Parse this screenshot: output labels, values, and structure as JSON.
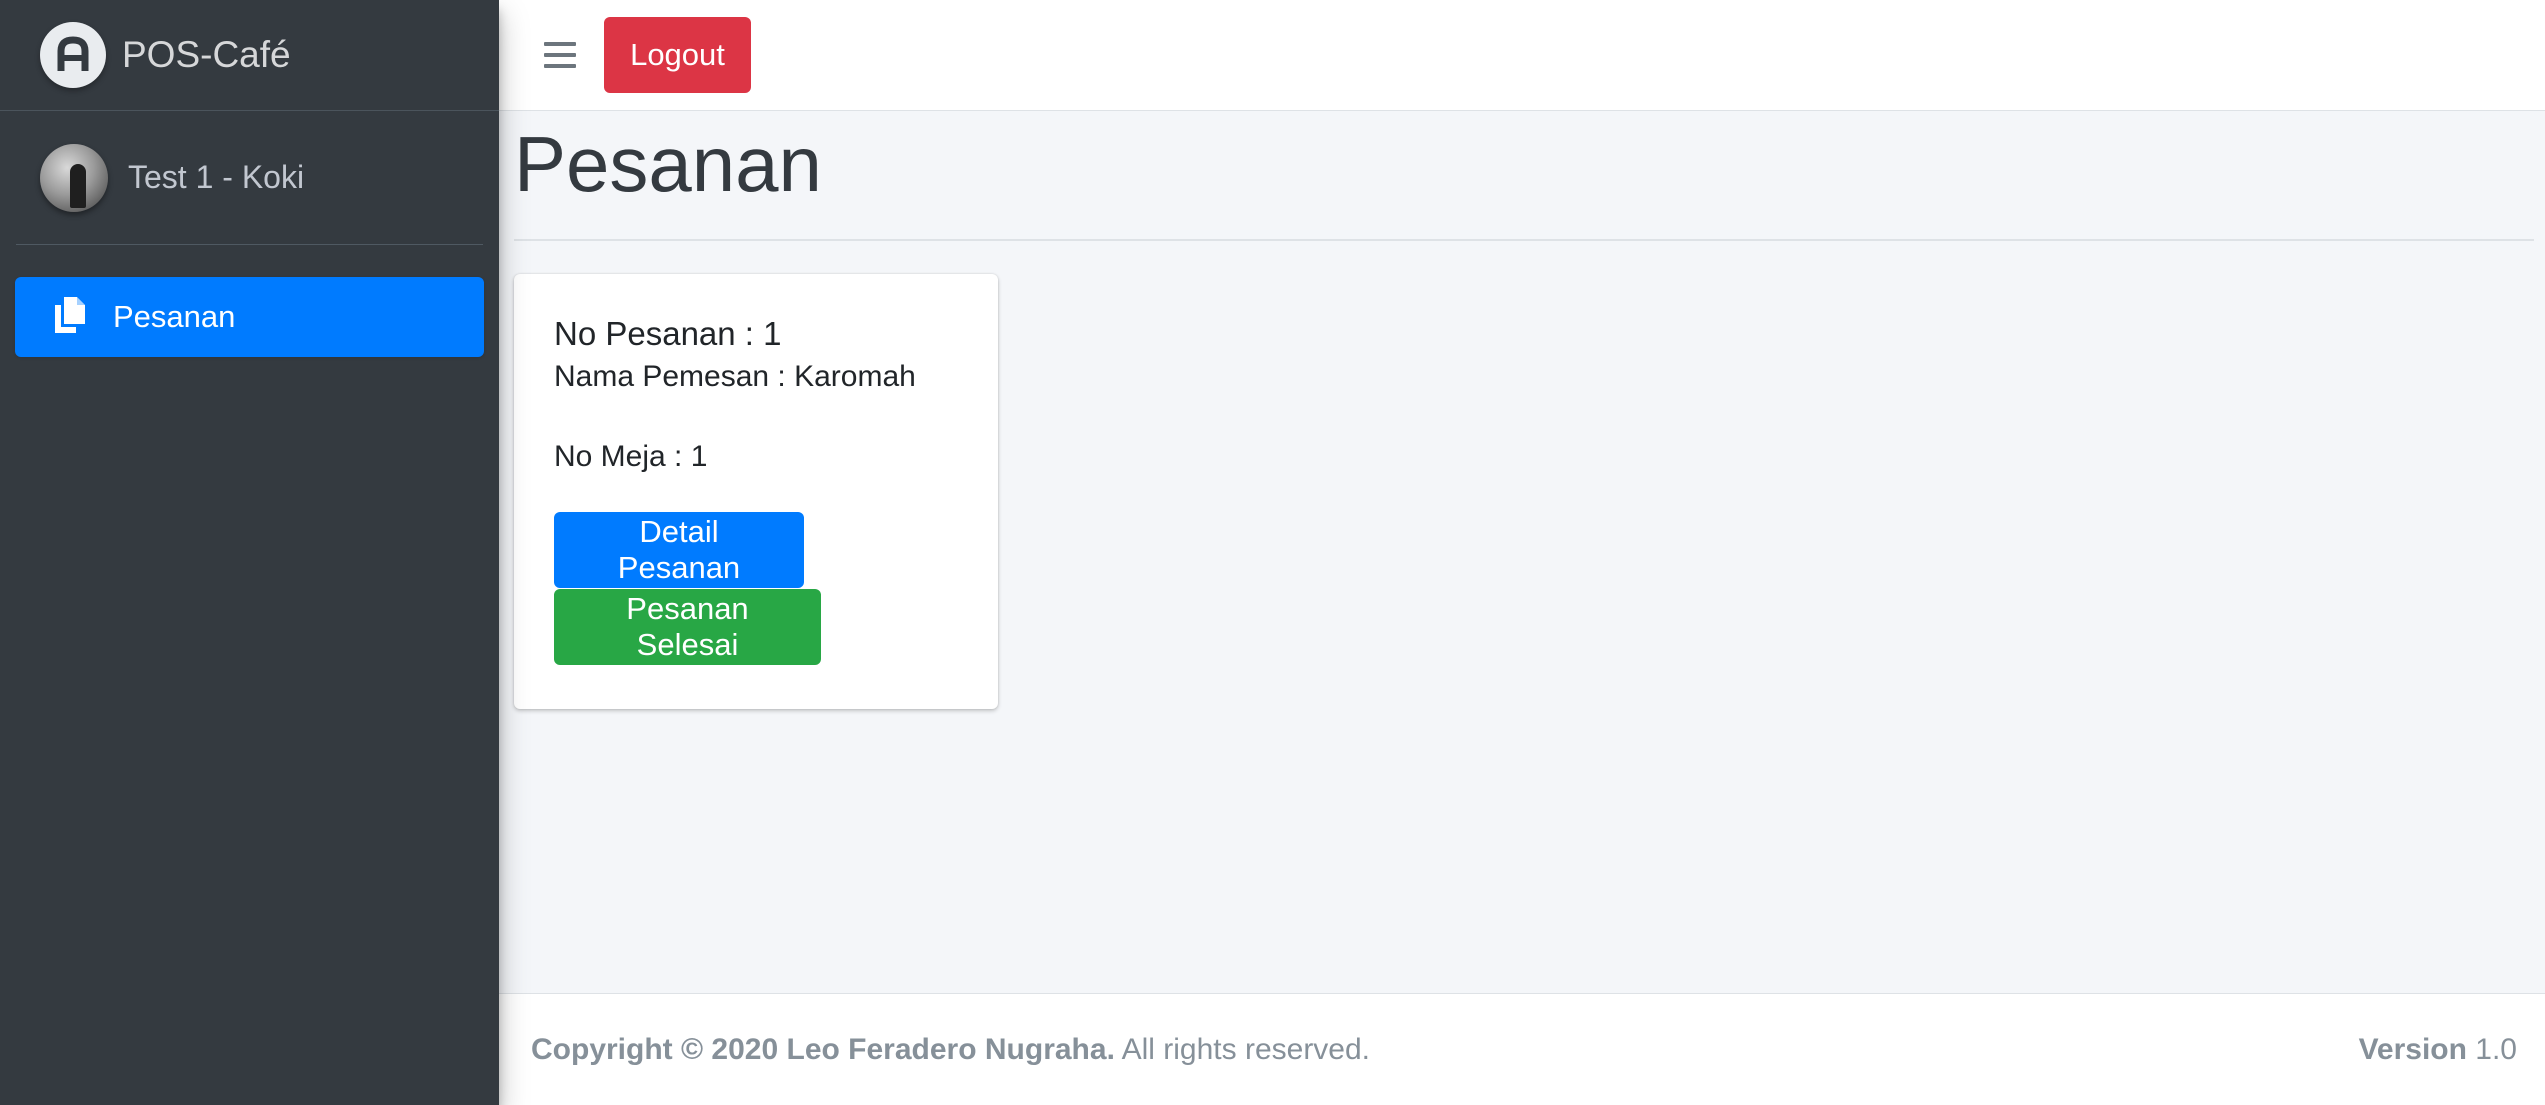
{
  "brand": {
    "name": "POS-Café",
    "logo_icon": "letter-a-logo-icon"
  },
  "user": {
    "name": "Test 1 - Koki"
  },
  "sidebar": {
    "items": [
      {
        "label": "Pesanan",
        "icon": "copy-files-icon",
        "active": true
      }
    ]
  },
  "navbar": {
    "menu_icon": "hamburger-menu-icon",
    "logout_label": "Logout"
  },
  "page": {
    "title": "Pesanan"
  },
  "orders": [
    {
      "order_no": "No Pesanan : 1",
      "customer": "Nama Pemesan : Karomah",
      "table": "No Meja : 1",
      "detail_label": "Detail Pesanan",
      "done_label": "Pesanan Selesai"
    }
  ],
  "footer": {
    "copyright": "Copyright © 2020 Leo Feradero Nugraha.",
    "rights": " All rights reserved.",
    "version_label": "Version",
    "version_value": " 1.0"
  },
  "colors": {
    "sidebar_bg": "#343a40",
    "primary": "#007bff",
    "danger": "#dc3545",
    "success": "#28a745",
    "content_bg": "#f4f6f9"
  }
}
